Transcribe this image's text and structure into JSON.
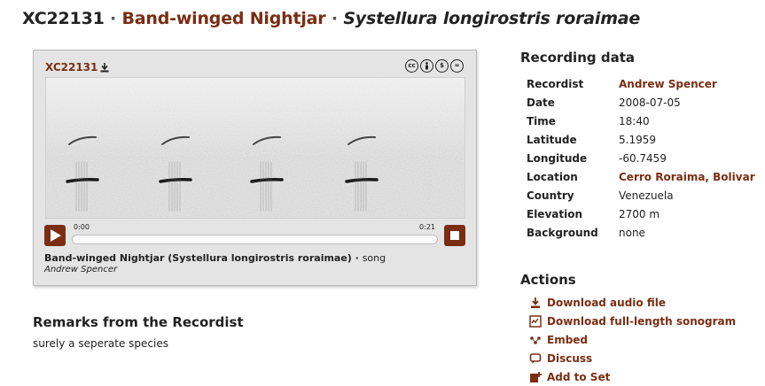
{
  "header": {
    "catalog_id": "XC22131",
    "separator": "·",
    "common_name": "Band-winged Nightjar",
    "scientific_name": "Systellura longirostris roraimae"
  },
  "player": {
    "catalog_id": "XC22131",
    "license_icons": [
      "cc-icon",
      "by-icon",
      "nc-icon",
      "nd-icon"
    ],
    "time_start": "0:00",
    "time_end": "0:21",
    "caption_name": "Band-winged Nightjar (Systellura longirostris roraimae)",
    "caption_sep": " · ",
    "caption_type": "song",
    "caption_recordist": "Andrew Spencer",
    "progress": 0
  },
  "remarks": {
    "title": "Remarks from the Recordist",
    "text": "surely a seperate species"
  },
  "recording": {
    "title": "Recording data",
    "rows": [
      {
        "label": "Recordist",
        "value": "Andrew Spencer",
        "link": true
      },
      {
        "label": "Date",
        "value": "2008-07-05",
        "link": false
      },
      {
        "label": "Time",
        "value": "18:40",
        "link": false
      },
      {
        "label": "Latitude",
        "value": "5.1959",
        "link": false
      },
      {
        "label": "Longitude",
        "value": "-60.7459",
        "link": false
      },
      {
        "label": "Location",
        "value": "Cerro Roraima, Bolivar",
        "link": true
      },
      {
        "label": "Country",
        "value": "Venezuela",
        "link": false
      },
      {
        "label": "Elevation",
        "value": "2700 m",
        "link": false
      },
      {
        "label": "Background",
        "value": "none",
        "link": false
      }
    ]
  },
  "actions": {
    "title": "Actions",
    "items": [
      {
        "label": "Download audio file",
        "icon": "download-icon"
      },
      {
        "label": "Download full-length sonogram",
        "icon": "sonogram-icon"
      },
      {
        "label": "Embed",
        "icon": "embed-icon"
      },
      {
        "label": "Discuss",
        "icon": "discuss-icon"
      },
      {
        "label": "Add to Set",
        "icon": "add-to-set-icon"
      }
    ]
  },
  "colors": {
    "accent": "#7a2d12",
    "card_bg": "#e4e4e4",
    "text": "#222222"
  }
}
